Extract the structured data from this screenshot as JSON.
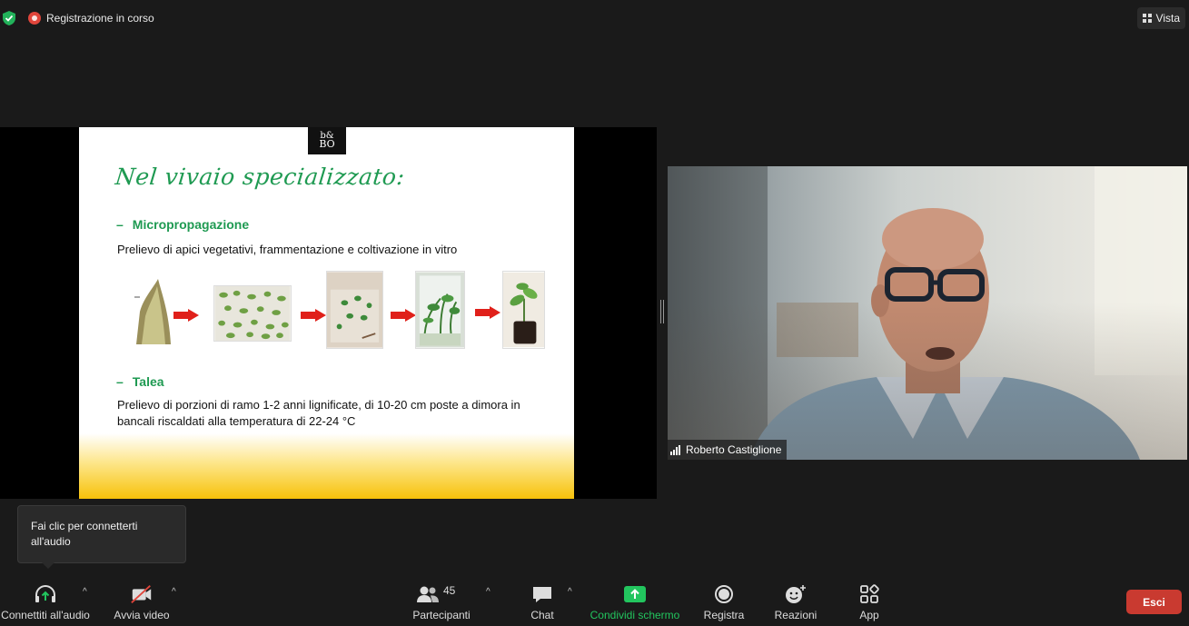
{
  "topbar": {
    "recording_label": "Registrazione in corso",
    "view_label": "Vista"
  },
  "slide": {
    "logo_text": "BO",
    "title": "Nel vivaio specializzato:",
    "section1_title": "Micropropagazione",
    "section1_text": "Prelievo di apici vegetativi, frammentazione e coltivazione in vitro",
    "section2_title": "Talea",
    "section2_text_line1": "Prelievo di porzioni di ramo 1-2 anni lignificate, di 10-20 cm poste a dimora in",
    "section2_text_line2": "bancali riscaldati alla temperatura di 22-24 °C",
    "bullet_mark": "–"
  },
  "participant_video": {
    "name": "Roberto Castiglione"
  },
  "tooltip": {
    "line1": "Fai clic per connetterti",
    "line2": "all'audio"
  },
  "toolbar": {
    "audio_label": "Connettiti all'audio",
    "video_label": "Avvia video",
    "participants_label": "Partecipanti",
    "participants_count": "45",
    "chat_label": "Chat",
    "share_label": "Condividi schermo",
    "record_label": "Registra",
    "reactions_label": "Reazioni",
    "apps_label": "App",
    "leave_label": "Esci",
    "share_color": "#22c55e",
    "leave_color": "#c93a30"
  }
}
